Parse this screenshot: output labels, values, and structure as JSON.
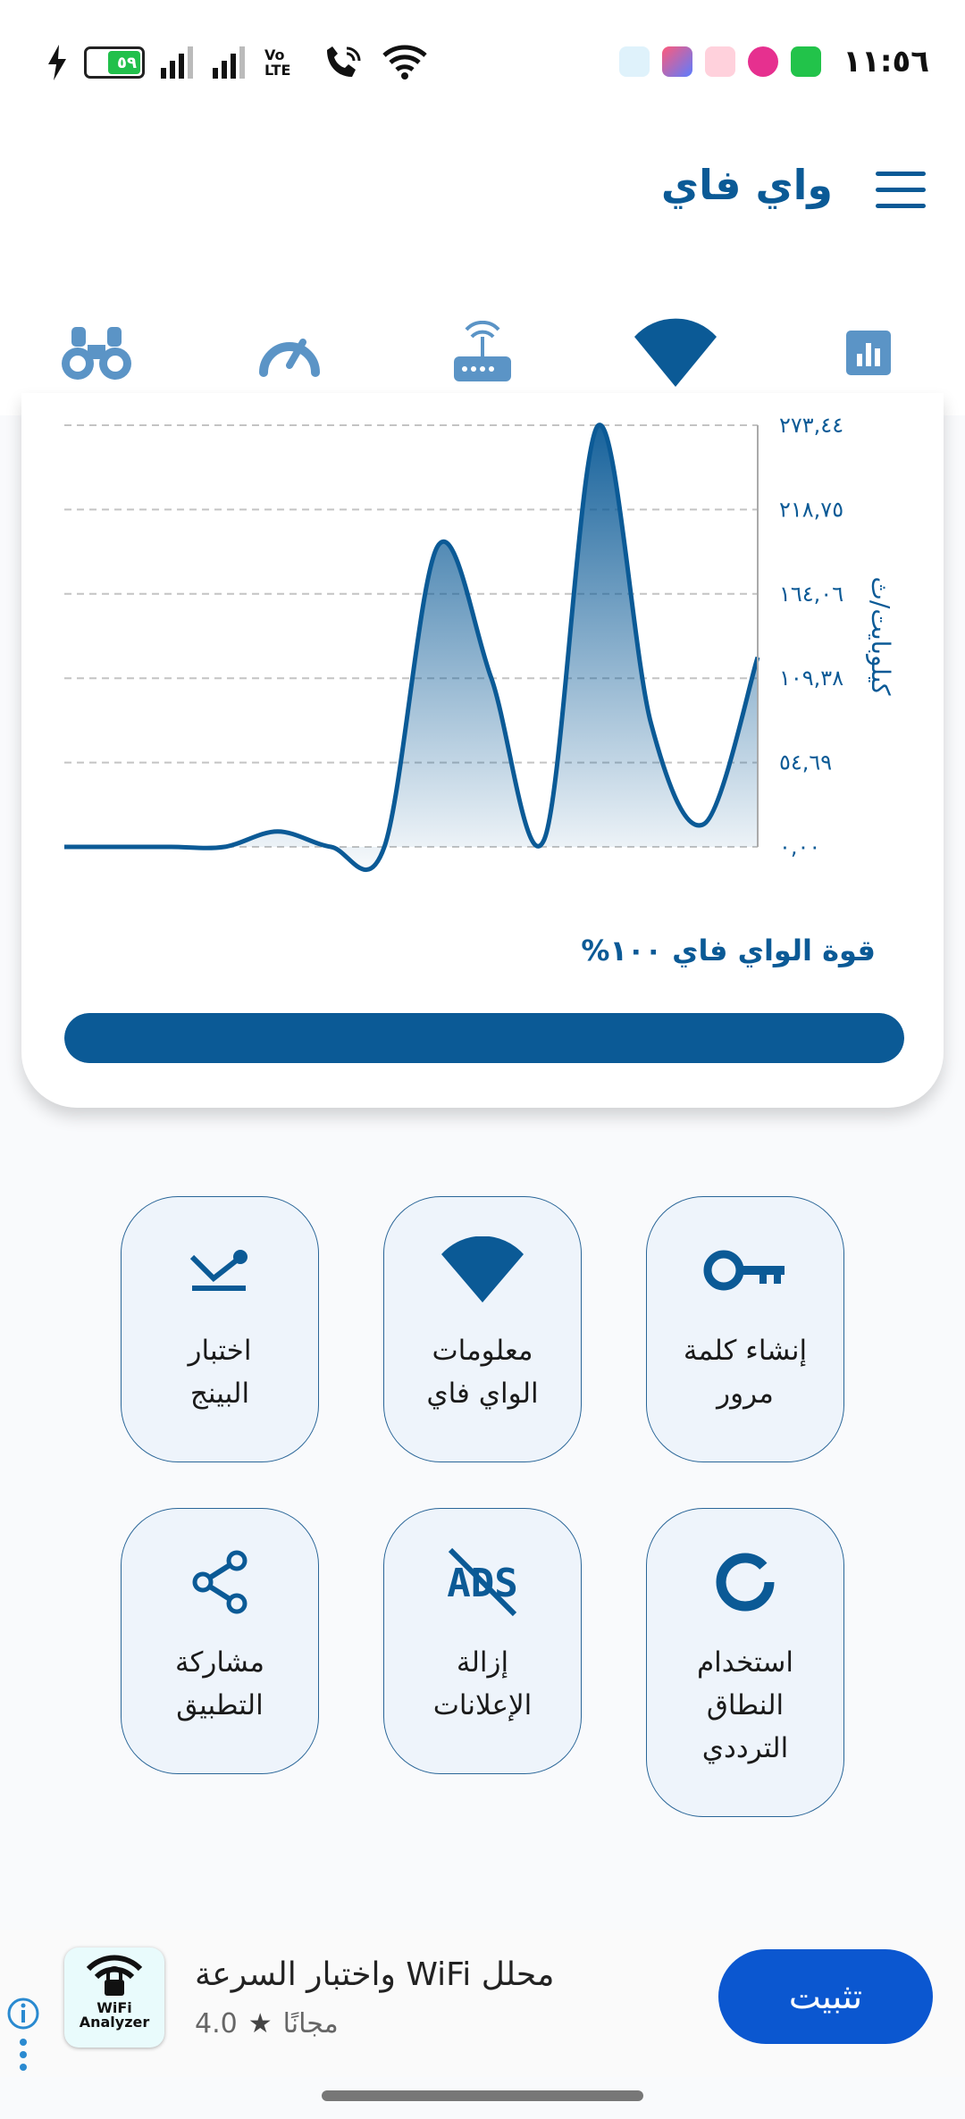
{
  "status_bar": {
    "battery_level": "٥٩",
    "time": "١١:٥٦",
    "network_label": "Vo LTE",
    "sim_label": "2"
  },
  "app_bar": {
    "title": "واي فاي"
  },
  "tabs": [
    {
      "name": "stats",
      "icon": "bar-chart-icon"
    },
    {
      "name": "wifi",
      "icon": "wifi-icon",
      "selected": true
    },
    {
      "name": "router",
      "icon": "router-icon"
    },
    {
      "name": "speed",
      "icon": "speedometer-icon"
    },
    {
      "name": "scan",
      "icon": "binoculars-icon"
    }
  ],
  "chart_data": {
    "type": "area",
    "ylabel": "كيلوبايت/ث",
    "y_tick_labels": [
      "٠,٠٠",
      "٥٤,٦٩",
      "١٠٩,٣٨",
      "١٦٤,٠٦",
      "٢١٨,٧٥",
      "٢٧٣,٤٤"
    ],
    "ylim": [
      0,
      273.44
    ],
    "values": [
      0,
      0,
      0,
      0,
      10,
      0,
      0,
      195,
      110,
      5,
      273,
      80,
      15,
      123
    ],
    "grid": true,
    "color": "#0b5a96"
  },
  "strength": {
    "label": "قوة الواي فاي ١٠٠%",
    "percent": 100
  },
  "tiles": [
    {
      "label_line1": "إنشاء كلمة",
      "label_line2": "مرور",
      "icon": "key-icon"
    },
    {
      "label_line1": "معلومات",
      "label_line2": "الواي فاي",
      "icon": "wifi-icon"
    },
    {
      "label_line1": "اختبار",
      "label_line2": "البينج",
      "icon": "ping-icon"
    },
    {
      "label_line1": "استخدام",
      "label_line2": "النطاق",
      "label_line3": "الترددي",
      "icon": "bandwidth-icon"
    },
    {
      "label_line1": "إزالة",
      "label_line2": "الإعلانات",
      "icon": "no-ads-icon",
      "ads_text": "ADS"
    },
    {
      "label_line1": "مشاركة",
      "label_line2": "التطبيق",
      "icon": "share-icon"
    }
  ],
  "ad": {
    "icon_text_1": "WiFi",
    "icon_text_2": "Analyzer",
    "title": "محلل WiFi واختبار السرعة",
    "free_label": "مجانًا",
    "rating": "4.0",
    "install_label": "تثبيت",
    "button_color": "#0b57d0"
  }
}
